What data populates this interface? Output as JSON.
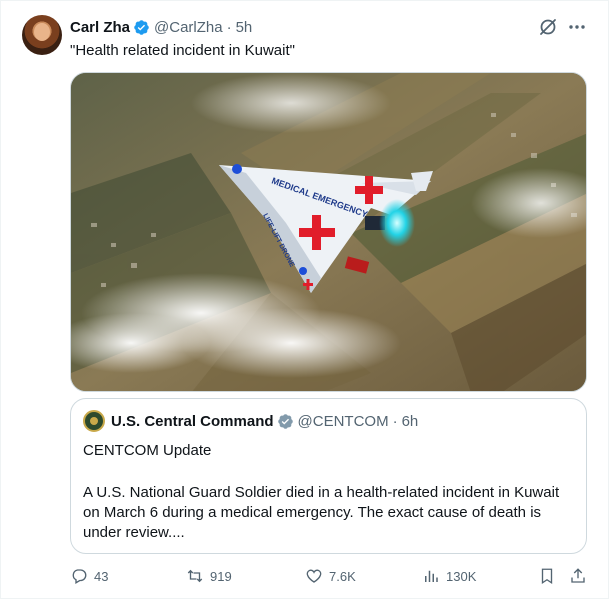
{
  "author": {
    "name": "Carl Zha",
    "handle": "@CarlZha",
    "separator": "·",
    "time": "5h"
  },
  "tweet_text": "\"Health related incident in Kuwait\"",
  "media": {
    "plane_text_main": "MEDICAL EMERGENCY",
    "plane_text_tail": "LIFE-LIFT DRONE"
  },
  "quote": {
    "name": "U.S. Central Command",
    "handle": "@CENTCOM",
    "separator": "·",
    "time": "6h",
    "line1": "CENTCOM Update",
    "body": "A U.S. National Guard Soldier died in a health-related incident in Kuwait on March 6 during a medical emergency. The exact cause of death is under review...."
  },
  "actions": {
    "replies": "43",
    "reposts": "919",
    "likes": "7.6K",
    "views": "130K"
  },
  "colors": {
    "verified": "#1d9bf0",
    "muted": "#536471",
    "border": "#cfd9de"
  }
}
